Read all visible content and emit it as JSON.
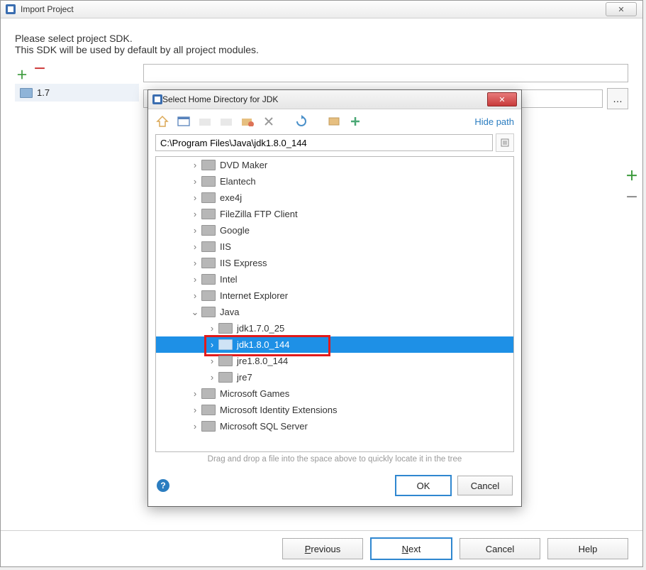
{
  "main_window": {
    "title": "Import Project",
    "heading": "Please select project SDK.",
    "subheading": "This SDK will be used by default by all project modules.",
    "sdk_list_item": "1.7",
    "buttons": {
      "previous": "Previous",
      "next": "Next",
      "cancel": "Cancel",
      "help": "Help"
    }
  },
  "dialog": {
    "title": "Select Home Directory for JDK",
    "hide_path": "Hide path",
    "path": "C:\\Program Files\\Java\\jdk1.8.0_144",
    "hint": "Drag and drop a file into the space above to quickly locate it in the tree",
    "buttons": {
      "ok": "OK",
      "cancel": "Cancel"
    },
    "tree": [
      {
        "indent": 2,
        "arrow": ">",
        "label": "DVD Maker"
      },
      {
        "indent": 2,
        "arrow": ">",
        "label": "Elantech"
      },
      {
        "indent": 2,
        "arrow": ">",
        "label": "exe4j"
      },
      {
        "indent": 2,
        "arrow": ">",
        "label": "FileZilla FTP Client"
      },
      {
        "indent": 2,
        "arrow": ">",
        "label": "Google"
      },
      {
        "indent": 2,
        "arrow": ">",
        "label": "IIS"
      },
      {
        "indent": 2,
        "arrow": ">",
        "label": "IIS Express"
      },
      {
        "indent": 2,
        "arrow": ">",
        "label": "Intel"
      },
      {
        "indent": 2,
        "arrow": ">",
        "label": "Internet Explorer"
      },
      {
        "indent": 2,
        "arrow": "v",
        "label": "Java"
      },
      {
        "indent": 3,
        "arrow": ">",
        "label": "jdk1.7.0_25"
      },
      {
        "indent": 3,
        "arrow": ">",
        "label": "jdk1.8.0_144",
        "selected": true,
        "highlighted": true
      },
      {
        "indent": 3,
        "arrow": ">",
        "label": "jre1.8.0_144"
      },
      {
        "indent": 3,
        "arrow": ">",
        "label": "jre7"
      },
      {
        "indent": 2,
        "arrow": ">",
        "label": "Microsoft Games"
      },
      {
        "indent": 2,
        "arrow": ">",
        "label": "Microsoft Identity Extensions"
      },
      {
        "indent": 2,
        "arrow": ">",
        "label": "Microsoft SQL Server"
      }
    ]
  }
}
